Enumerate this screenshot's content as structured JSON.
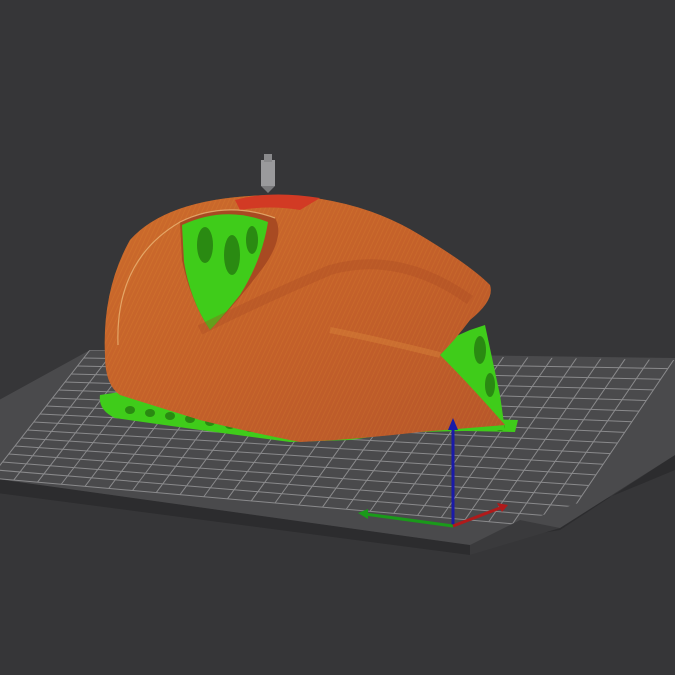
{
  "viewport": {
    "background": "#363638",
    "bed_color": "#4a4a4c",
    "bed_edge_color": "#2c2c2e",
    "grid_color": "#8a8a8c",
    "grid_visible": true
  },
  "model": {
    "shell_color": "#c8662a",
    "shell_highlight_color": "#d9852f",
    "top_color": "#d23a24",
    "support_color": "#3fcc1a"
  },
  "nozzle": {
    "icon": "nozzle-icon",
    "color": "#9a9a9c"
  },
  "axes": {
    "icon": "axes-gizmo-icon",
    "x_color": "#b01a1a",
    "y_color": "#1a9a1a",
    "z_color": "#1a1aa8"
  }
}
